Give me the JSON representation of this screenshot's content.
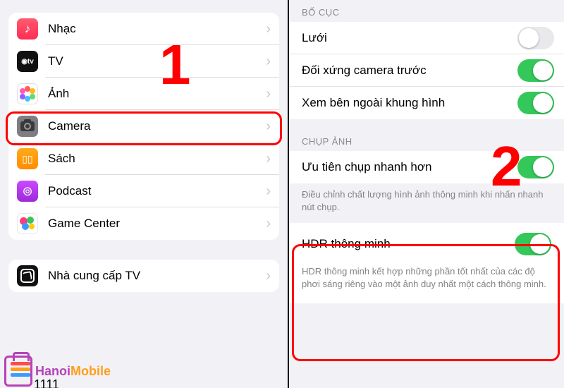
{
  "annotations": {
    "step1": "1",
    "step2": "2"
  },
  "left": {
    "items": [
      {
        "label": "Nhạc"
      },
      {
        "label": "TV"
      },
      {
        "label": "Ảnh"
      },
      {
        "label": "Camera"
      },
      {
        "label": "Sách"
      },
      {
        "label": "Podcast"
      },
      {
        "label": "Game Center"
      }
    ],
    "group2": [
      {
        "label": "Nhà cung cấp TV"
      }
    ],
    "partial": "1111"
  },
  "right": {
    "section1_header": "BỐ CỤC",
    "section1": [
      {
        "label": "Lưới",
        "on": false
      },
      {
        "label": "Đối xứng camera trước",
        "on": true
      },
      {
        "label": "Xem bên ngoài khung hình",
        "on": true
      }
    ],
    "section2_header": "CHỤP ẢNH",
    "section2": [
      {
        "label": "Ưu tiên chụp nhanh hơn",
        "on": true
      }
    ],
    "section2_footer": "Điều chỉnh chất lượng hình ảnh thông minh khi nhấn nhanh nút chụp.",
    "hdr": {
      "label": "HDR thông minh",
      "on": true,
      "footer": "HDR thông minh kết hợp những phần tốt nhất của các độ phơi sáng riêng vào một ảnh duy nhất một cách thông minh."
    }
  },
  "watermark": {
    "brand_left": "Hanoi",
    "brand_right": "Mobile"
  }
}
